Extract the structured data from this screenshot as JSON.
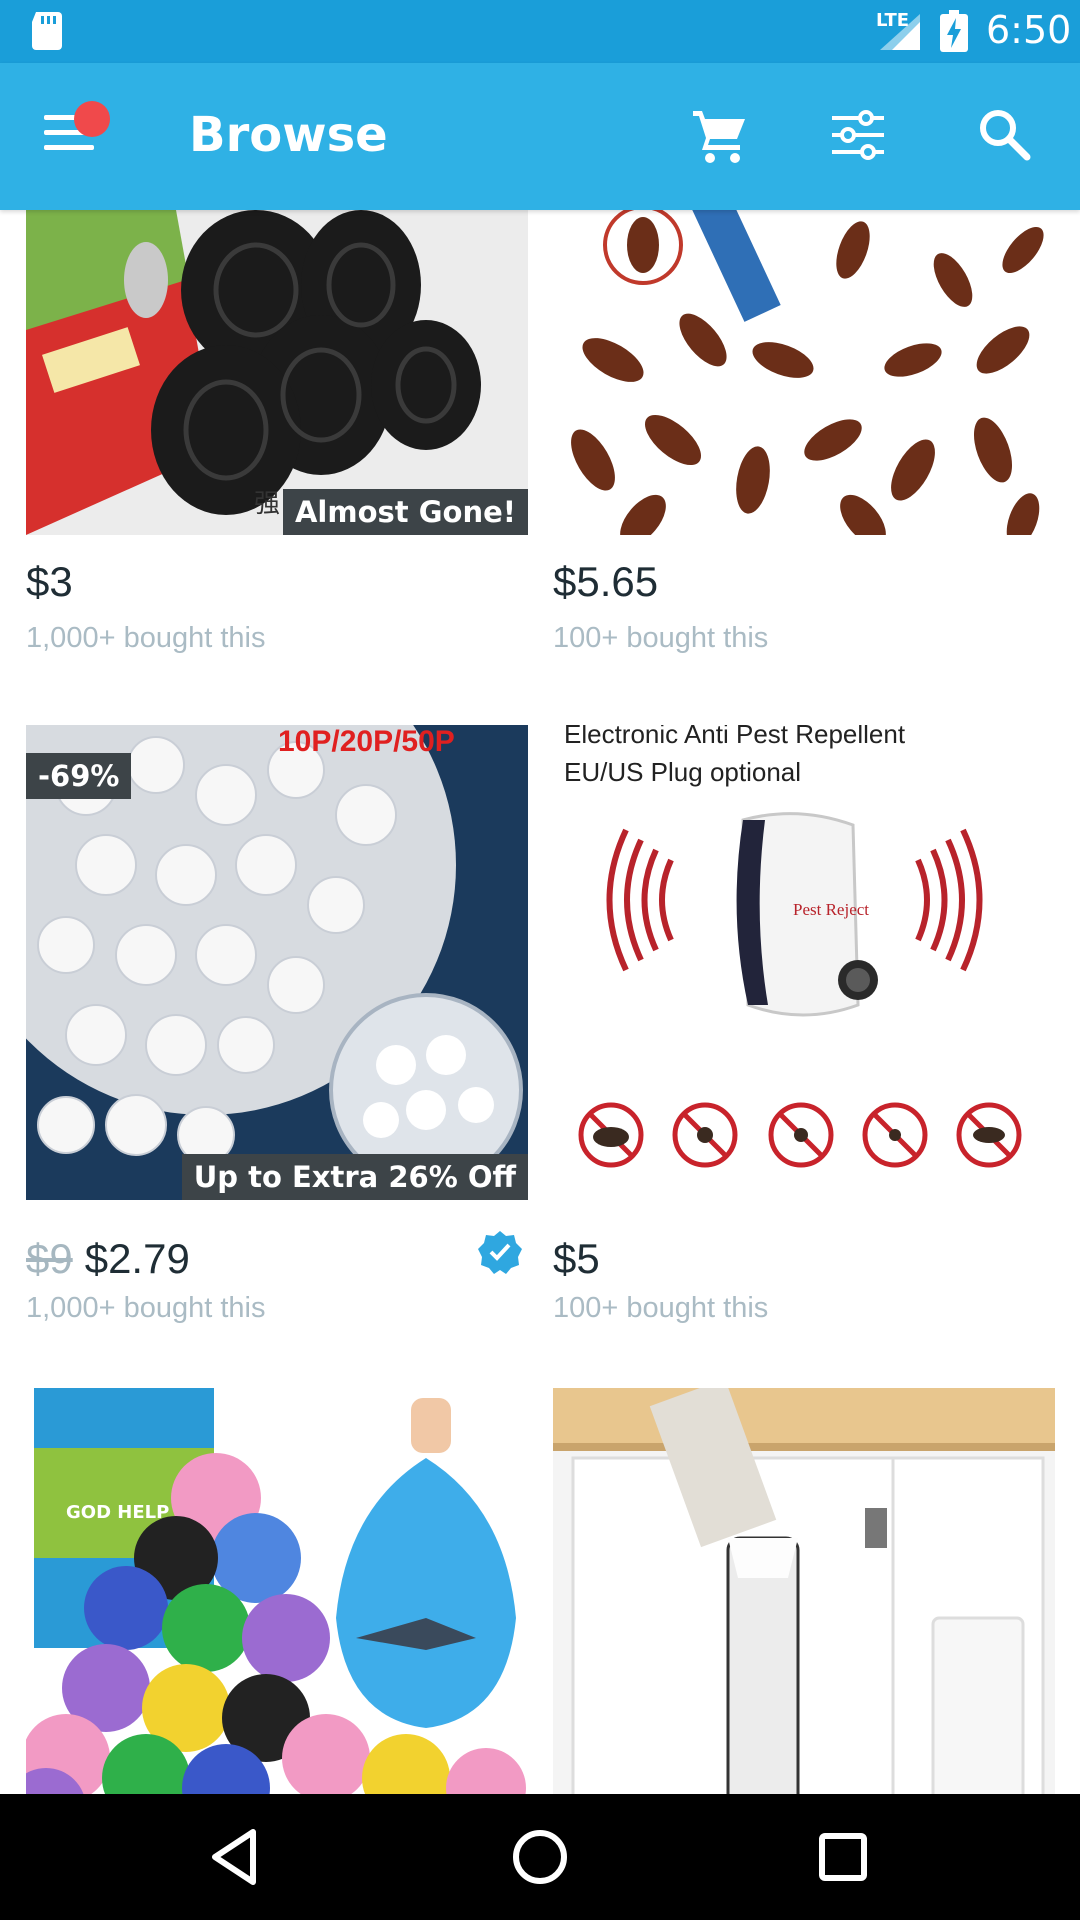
{
  "status_bar": {
    "network": "LTE",
    "time": "6:50"
  },
  "app_bar": {
    "title": "Browse",
    "icons": [
      "menu-icon",
      "cart-icon",
      "filter-icon",
      "search-icon"
    ],
    "colors": {
      "bar": "#2fb1e5",
      "status": "#1a9ed9",
      "notification_dot": "#f0494b"
    }
  },
  "products": [
    {
      "price": "$3",
      "sold": "1,000+ bought this",
      "badge": "Almost Gone!",
      "image_text": "强"
    },
    {
      "price": "$5.65",
      "sold": "100+ bought this"
    },
    {
      "old_price": "$9",
      "price": "$2.79",
      "sold": "1,000+ bought this",
      "discount": "-69%",
      "image_text": "10P/20P/50P",
      "badge": "Up to Extra 26% Off",
      "verified": true
    },
    {
      "price": "$5",
      "sold": "100+ bought this",
      "image_text_1": "Electronic Anti Pest Repellent",
      "image_text_2": "EU/US Plug optional",
      "logo_text": "Pest Reject"
    },
    {
      "image_text": "GOD HELP"
    },
    {}
  ],
  "nav_bar": {
    "icons": [
      "back-icon",
      "home-icon",
      "recents-icon"
    ]
  }
}
